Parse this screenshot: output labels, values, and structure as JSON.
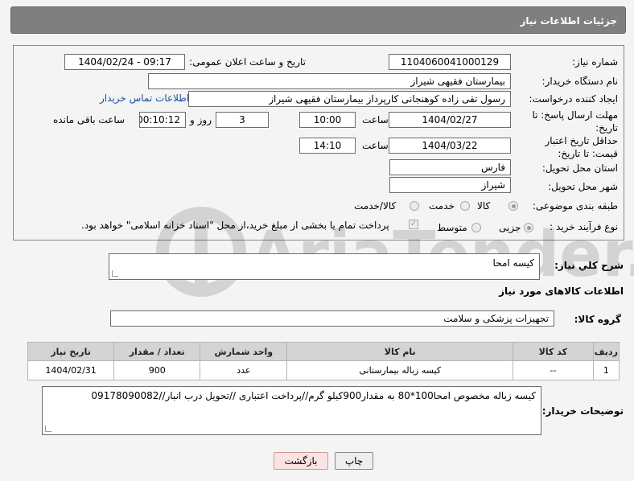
{
  "page": {
    "title": "جزئیات اطلاعات نیاز"
  },
  "form": {
    "need_number": {
      "label": "شماره نیاز:",
      "value": "1104060041000129"
    },
    "announce_datetime": {
      "label": "تاریخ و ساعت اعلان عمومی:",
      "value": "1404/02/24 - 09:17"
    },
    "buyer_org": {
      "label": "نام دستگاه خریدار:",
      "value": "بیمارستان فقیهی شیراز"
    },
    "requester": {
      "label": "ایجاد کننده درخواست:",
      "value": "رسول تقی زاده کوهنجانی کارپرداز بیمارستان فقیهی شیراز",
      "contact_link": "اطلاعات تماس خریدار"
    },
    "reply_deadline": {
      "label": "مهلت ارسال پاسخ: تا تاریخ:",
      "date": "1404/02/27",
      "time_label": "ساعت",
      "time": "10:00",
      "days": "3",
      "days_label": "روز و",
      "remaining": "00:10:12",
      "remaining_label": "ساعت باقی مانده"
    },
    "price_validity": {
      "label": "حداقل تاریخ اعتبار قیمت: تا تاریخ:",
      "date": "1404/03/22",
      "time_label": "ساعت",
      "time": "14:10"
    },
    "delivery_province": {
      "label": "استان محل تحویل:",
      "value": "فارس"
    },
    "delivery_city": {
      "label": "شهر محل تحویل:",
      "value": "شیراز"
    },
    "category": {
      "label": "طبقه بندی موضوعی:",
      "options": [
        "کالا",
        "خدمت",
        "کالا/خدمت"
      ],
      "selected": "کالا"
    },
    "process_type": {
      "label": "نوع فرآیند خرید :",
      "options": [
        "جزیی",
        "متوسط"
      ],
      "selected": "جزیی",
      "payment_note": "پرداخت تمام یا بخشی از مبلغ خرید،از محل \"اسناد خزانه اسلامی\" خواهد بود."
    }
  },
  "description": {
    "label": "شرح کلي نياز:",
    "value": "کیسه امحا"
  },
  "goods_section": {
    "title": "اطلاعات کالاهای مورد نیاز"
  },
  "goods_group": {
    "label": "گروه کالا:",
    "value": "تجهیزات پزشکی و سلامت"
  },
  "items_table": {
    "headers": [
      "ردیف",
      "کد کالا",
      "نام کالا",
      "واحد شمارش",
      "تعداد / مقدار",
      "تاریخ نیاز"
    ],
    "rows": [
      [
        "1",
        "--",
        "کیسه زباله بیمارستانی",
        "عدد",
        "900",
        "1404/02/31"
      ]
    ]
  },
  "buyer_notes": {
    "label": "توضیحات خریدار:",
    "value": "کیسه زباله مخصوص امحا100*80 به مقدار900کیلو گرم//پرداخت اعتباری //تحویل درب انبار//09178090082"
  },
  "buttons": {
    "print": "چاپ",
    "back": "بازگشت"
  },
  "watermark": {
    "text": "AriaTender.neT"
  }
}
